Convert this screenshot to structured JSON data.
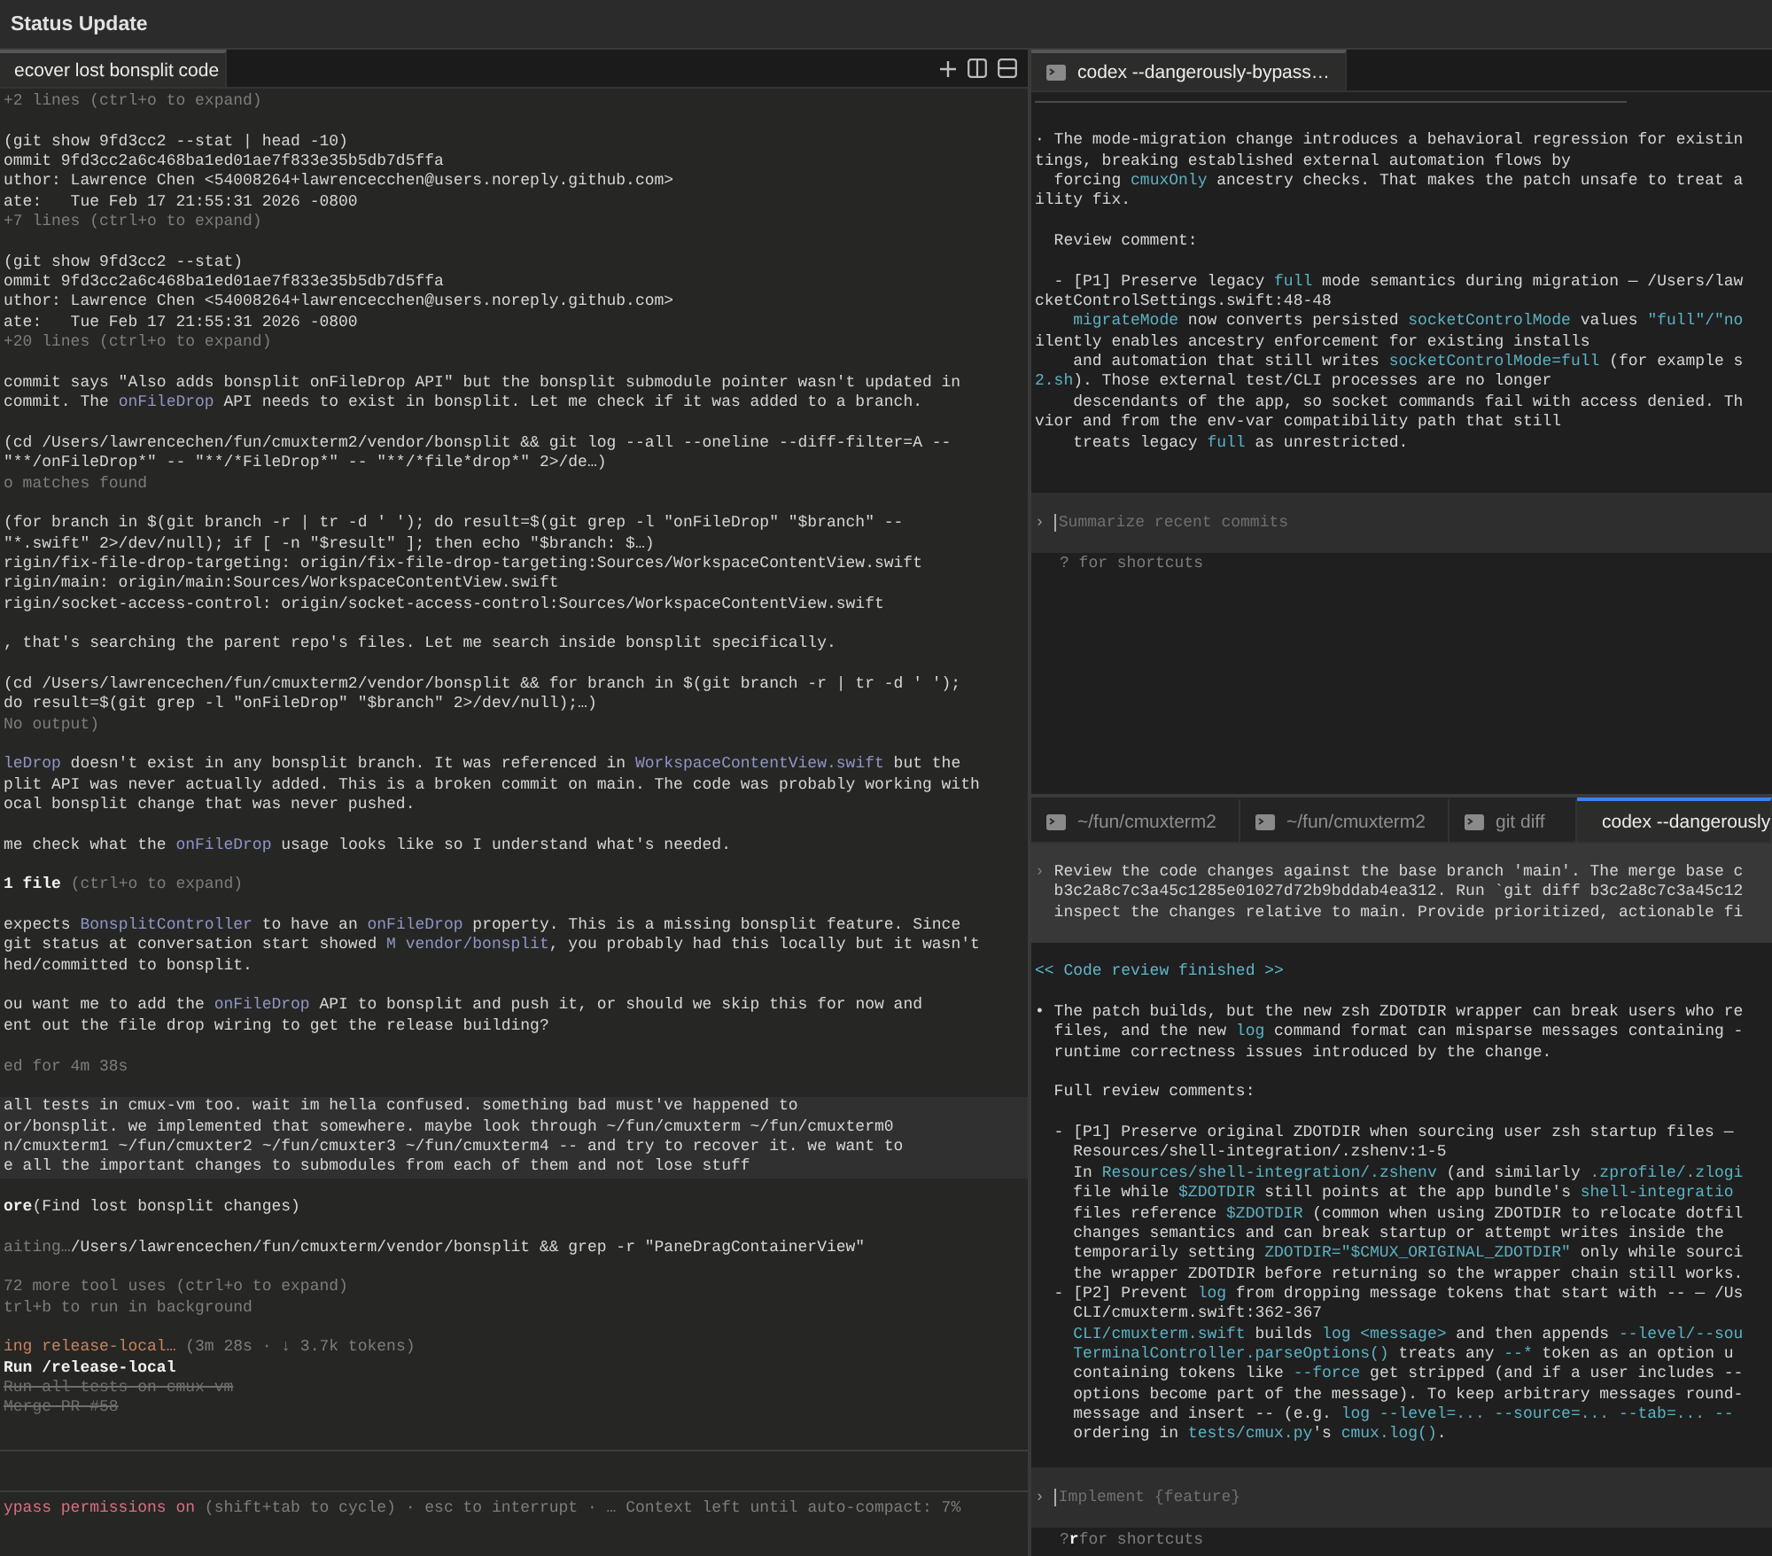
{
  "window": {
    "title": "Status Update"
  },
  "left_pane": {
    "tabs": [
      {
        "label": "ecover lost bonsplit code",
        "selected": true
      }
    ],
    "blocks": [
      {
        "kind": "output",
        "lines": [
          [
            {
              "text": "+2 lines (ctrl+o to expand)",
              "kind": "dim"
            }
          ]
        ]
      },
      {
        "kind": "output",
        "lines": [
          "(git show 9fd3cc2 --stat | head -10)",
          "ommit 9fd3cc2a6c468ba1ed01ae7f833e35b5db7d5ffa",
          "uthor: Lawrence Chen <54008264+lawrencecchen@users.noreply.github.com>",
          "ate:   Tue Feb 17 21:55:31 2026 -0800",
          [
            {
              "text": "+7 lines (ctrl+o to expand)",
              "kind": "dim"
            }
          ]
        ]
      },
      {
        "kind": "output",
        "lines": [
          "(git show 9fd3cc2 --stat)",
          "ommit 9fd3cc2a6c468ba1ed01ae7f833e35b5db7d5ffa",
          "uthor: Lawrence Chen <54008264+lawrencecchen@users.noreply.github.com>",
          "ate:   Tue Feb 17 21:55:31 2026 -0800",
          [
            {
              "text": "+20 lines (ctrl+o to expand)",
              "kind": "dim"
            }
          ]
        ]
      },
      {
        "kind": "output",
        "lines": [
          "commit says \"Also adds bonsplit onFileDrop API\" but the bonsplit submodule pointer wasn't updated in",
          [
            {
              "text": "commit. The ",
              "kind": "plain"
            },
            {
              "text": "onFileDrop",
              "kind": "accent"
            },
            {
              "text": " API needs to exist in bonsplit. Let me check if it was added to a branch.",
              "kind": "plain"
            }
          ]
        ]
      },
      {
        "kind": "output",
        "lines": [
          "(cd /Users/lawrencechen/fun/cmuxterm2/vendor/bonsplit && git log --all --oneline --diff-filter=A --",
          "\"**/onFileDrop*\" -- \"**/*FileDrop*\" -- \"**/*file*drop*\" 2>/de…)",
          [
            {
              "text": "o matches found",
              "kind": "dim"
            }
          ]
        ]
      },
      {
        "kind": "output",
        "lines": [
          "(for branch in $(git branch -r | tr -d ' '); do result=$(git grep -l \"onFileDrop\" \"$branch\" --",
          "\"*.swift\" 2>/dev/null); if [ -n \"$result\" ]; then echo \"$branch: $…)",
          "rigin/fix-file-drop-targeting: origin/fix-file-drop-targeting:Sources/WorkspaceContentView.swift",
          "rigin/main: origin/main:Sources/WorkspaceContentView.swift",
          "rigin/socket-access-control: origin/socket-access-control:Sources/WorkspaceContentView.swift"
        ]
      },
      {
        "kind": "output",
        "lines": [
          ", that's searching the parent repo's files. Let me search inside bonsplit specifically."
        ]
      },
      {
        "kind": "output",
        "lines": [
          "(cd /Users/lawrencechen/fun/cmuxterm2/vendor/bonsplit && for branch in $(git branch -r | tr -d ' ');",
          "do result=$(git grep -l \"onFileDrop\" \"$branch\" 2>/dev/null);…)",
          [
            {
              "text": "No output)",
              "kind": "dim"
            }
          ]
        ]
      },
      {
        "kind": "output",
        "lines": [
          [
            {
              "text": "leDrop",
              "kind": "accent"
            },
            {
              "text": " doesn't exist in any bonsplit branch. It was referenced in ",
              "kind": "plain"
            },
            {
              "text": "WorkspaceContentView.swift",
              "kind": "accent"
            },
            {
              "text": " but the",
              "kind": "plain"
            }
          ],
          "plit API was never actually added. This is a broken commit on main. The code was probably working with",
          "ocal bonsplit change that was never pushed."
        ]
      },
      {
        "kind": "output",
        "lines": [
          [
            {
              "text": "me check what the ",
              "kind": "plain"
            },
            {
              "text": "onFileDrop",
              "kind": "accent"
            },
            {
              "text": " usage looks like so I understand what's needed.",
              "kind": "plain"
            }
          ]
        ]
      },
      {
        "kind": "output",
        "lines": [
          [
            {
              "text": "1 file ",
              "kind": "bold"
            },
            {
              "text": "(ctrl+o to expand)",
              "kind": "dim"
            }
          ]
        ]
      },
      {
        "kind": "output",
        "lines": [
          [
            {
              "text": "expects ",
              "kind": "plain"
            },
            {
              "text": "BonsplitController",
              "kind": "accent"
            },
            {
              "text": " to have an ",
              "kind": "plain"
            },
            {
              "text": "onFileDrop",
              "kind": "accent"
            },
            {
              "text": " property. This is a missing bonsplit feature. Since",
              "kind": "plain"
            }
          ],
          [
            {
              "text": "git status at conversation start showed ",
              "kind": "plain"
            },
            {
              "text": "M vendor/bonsplit",
              "kind": "accent"
            },
            {
              "text": ", you probably had this locally but it wasn't",
              "kind": "plain"
            }
          ],
          "hed/committed to bonsplit."
        ]
      },
      {
        "kind": "output",
        "lines": [
          [
            {
              "text": "ou want me to add the ",
              "kind": "plain"
            },
            {
              "text": "onFileDrop",
              "kind": "accent"
            },
            {
              "text": " API to bonsplit and push it, or should we skip this for now and",
              "kind": "plain"
            }
          ],
          "ent out the file drop wiring to get the release building?"
        ]
      },
      {
        "kind": "output",
        "lines": [
          [
            {
              "text": "ed for 4m 38s",
              "kind": "dim"
            }
          ]
        ]
      },
      {
        "kind": "user",
        "lines": [
          "all tests in cmux-vm too. wait im hella confused. something bad must've happened to",
          "or/bonsplit. we implemented that somewhere. maybe look through ~/fun/cmuxterm ~/fun/cmuxterm0",
          "n/cmuxterm1 ~/fun/cmuxter2 ~/fun/cmuxter3 ~/fun/cmuxterm4 -- and try to recover it. we want to",
          "e all the important changes to submodules from each of them and not lose stuff"
        ]
      },
      {
        "kind": "output",
        "lines": [
          [
            {
              "text": "ore",
              "kind": "bold"
            },
            {
              "text": "(Find lost bonsplit changes)",
              "kind": "plain"
            }
          ]
        ]
      },
      {
        "kind": "output",
        "lines": [
          [
            {
              "text": "aiting…",
              "kind": "dim"
            },
            {
              "text": "/Users/lawrencechen/fun/cmuxterm/vendor/bonsplit && grep -r \"PaneDragContainerView\"",
              "kind": "plain"
            }
          ]
        ]
      },
      {
        "kind": "output",
        "lines": [
          [
            {
              "text": "72 more tool uses (ctrl+o to expand)",
              "kind": "dim"
            }
          ],
          [
            {
              "text": "trl+b to run in background",
              "kind": "dim"
            }
          ]
        ]
      },
      {
        "kind": "output",
        "lines": [
          [
            {
              "text": "ing release-local…",
              "kind": "orange"
            },
            {
              "text": " (3m 28s · ↓ 3.7k tokens)",
              "kind": "dim"
            }
          ],
          [
            {
              "text": "Run /release-local",
              "kind": "bold"
            }
          ],
          [
            {
              "text": "Run all tests on cmux-vm",
              "kind": "strike"
            }
          ],
          [
            {
              "text": "Merge PR #58",
              "kind": "strike"
            }
          ]
        ]
      }
    ],
    "status_line": [
      {
        "text": "ypass permissions on",
        "kind": "red"
      },
      {
        "text": " (shift+tab to cycle) · esc to interrupt · … Context left until auto-compact: 7%",
        "kind": "dim"
      }
    ]
  },
  "right_top_pane": {
    "tabs": [
      {
        "label": "codex --dangerously-bypass…",
        "selected": true
      }
    ],
    "blocks": [
      {
        "kind": "output",
        "lines": [
          "· The mode-migration change introduces a behavioral regression for existin",
          "tings, breaking established external automation flows by",
          [
            {
              "text": "  forcing ",
              "kind": "plain"
            },
            {
              "text": "cmuxOnly",
              "kind": "teal"
            },
            {
              "text": " ancestry checks. That makes the patch unsafe to treat a",
              "kind": "plain"
            }
          ],
          "ility fix."
        ]
      },
      {
        "kind": "output",
        "lines": [
          "  Review comment:"
        ]
      },
      {
        "kind": "output",
        "lines": [
          [
            {
              "text": "  - [P1] Preserve legacy ",
              "kind": "plain"
            },
            {
              "text": "full",
              "kind": "teal"
            },
            {
              "text": " mode semantics during migration — /Users/law",
              "kind": "plain"
            }
          ],
          "cketControlSettings.swift:48-48",
          [
            {
              "text": "    migrateMode",
              "kind": "teal"
            },
            {
              "text": " now converts persisted ",
              "kind": "plain"
            },
            {
              "text": "socketControlMode",
              "kind": "teal"
            },
            {
              "text": " values ",
              "kind": "plain"
            },
            {
              "text": "\"full\"/\"no",
              "kind": "teal"
            }
          ],
          "ilently enables ancestry enforcement for existing installs",
          [
            {
              "text": "    and automation that still writes ",
              "kind": "plain"
            },
            {
              "text": "socketControlMode=full",
              "kind": "teal"
            },
            {
              "text": " (for example s",
              "kind": "plain"
            }
          ],
          [
            {
              "text": "2.sh",
              "kind": "teal"
            },
            {
              "text": "). Those external test/CLI processes are no longer",
              "kind": "plain"
            }
          ],
          "    descendants of the app, so socket commands fail with access denied. Th",
          "vior and from the env-var compatibility path that still",
          [
            {
              "text": "    treats legacy ",
              "kind": "plain"
            },
            {
              "text": "full",
              "kind": "teal"
            },
            {
              "text": " as unrestricted.",
              "kind": "plain"
            }
          ]
        ]
      }
    ],
    "input": {
      "prompt": "›",
      "placeholder": "Summarize recent commits"
    },
    "hint": [
      {
        "text": "? for shortcuts",
        "kind": "dim"
      }
    ]
  },
  "right_bottom_pane": {
    "tabs": [
      {
        "label": "~/fun/cmuxterm2",
        "selected": false
      },
      {
        "label": "~/fun/cmuxterm2",
        "selected": false
      },
      {
        "label": "git diff",
        "selected": false
      },
      {
        "label": "codex --dangerously",
        "selected": true
      }
    ],
    "blocks": [
      {
        "kind": "user",
        "lines": [
          [
            {
              "text": "› ",
              "kind": "dim"
            },
            {
              "text": "Review the code changes against the base branch 'main'. The merge base c",
              "kind": "plain"
            }
          ],
          "  b3c2a8c7c3a45c1285e01027d72b9bddab4ea312. Run `git diff b3c2a8c7c3a45c12",
          "  inspect the changes relative to main. Provide prioritized, actionable fi"
        ]
      },
      {
        "kind": "output",
        "lines": [
          [
            {
              "text": "<< Code review finished >>",
              "kind": "cyan"
            }
          ]
        ]
      },
      {
        "kind": "output",
        "lines": [
          "• The patch builds, but the new zsh ZDOTDIR wrapper can break users who re",
          [
            {
              "text": "  files, and the new ",
              "kind": "plain"
            },
            {
              "text": "log",
              "kind": "teal"
            },
            {
              "text": " command format can misparse messages containing -",
              "kind": "plain"
            }
          ],
          "  runtime correctness issues introduced by the change."
        ]
      },
      {
        "kind": "output",
        "lines": [
          "  Full review comments:"
        ]
      },
      {
        "kind": "output",
        "lines": [
          "  - [P1] Preserve original ZDOTDIR when sourcing user zsh startup files —",
          "    Resources/shell-integration/.zshenv:1-5",
          [
            {
              "text": "    In ",
              "kind": "plain"
            },
            {
              "text": "Resources/shell-integration/.zshenv",
              "kind": "teal"
            },
            {
              "text": " (and similarly ",
              "kind": "plain"
            },
            {
              "text": ".zprofile/.zlogi",
              "kind": "teal"
            }
          ],
          [
            {
              "text": "    file while ",
              "kind": "plain"
            },
            {
              "text": "$ZDOTDIR",
              "kind": "teal"
            },
            {
              "text": " still points at the app bundle's ",
              "kind": "plain"
            },
            {
              "text": "shell-integratio",
              "kind": "teal"
            }
          ],
          [
            {
              "text": "    files reference ",
              "kind": "plain"
            },
            {
              "text": "$ZDOTDIR",
              "kind": "teal"
            },
            {
              "text": " (common when using ZDOTDIR to relocate dotfil",
              "kind": "plain"
            }
          ],
          "    changes semantics and can break startup or attempt writes inside the",
          [
            {
              "text": "    temporarily setting ",
              "kind": "plain"
            },
            {
              "text": "ZDOTDIR=\"$CMUX_ORIGINAL_ZDOTDIR\"",
              "kind": "teal"
            },
            {
              "text": " only while sourci",
              "kind": "plain"
            }
          ],
          "    the wrapper ZDOTDIR before returning so the wrapper chain still works.",
          [
            {
              "text": "  - [P2] Prevent ",
              "kind": "plain"
            },
            {
              "text": "log",
              "kind": "teal"
            },
            {
              "text": " from dropping message tokens that start with -- — /Us",
              "kind": "plain"
            }
          ],
          "    CLI/cmuxterm.swift:362-367",
          [
            {
              "text": "    CLI/cmuxterm.swift",
              "kind": "teal"
            },
            {
              "text": " builds ",
              "kind": "plain"
            },
            {
              "text": "log <message>",
              "kind": "teal"
            },
            {
              "text": " and then appends ",
              "kind": "plain"
            },
            {
              "text": "--level/--sou",
              "kind": "teal"
            }
          ],
          [
            {
              "text": "    TerminalController.parseOptions()",
              "kind": "teal"
            },
            {
              "text": " treats any ",
              "kind": "plain"
            },
            {
              "text": "--*",
              "kind": "teal"
            },
            {
              "text": " token as an option u",
              "kind": "plain"
            }
          ],
          [
            {
              "text": "    containing tokens like ",
              "kind": "plain"
            },
            {
              "text": "--force",
              "kind": "teal"
            },
            {
              "text": " get stripped (and if a user includes --",
              "kind": "plain"
            }
          ],
          "    options become part of the message). To keep arbitrary messages round-",
          [
            {
              "text": "    message and insert -- (e.g. ",
              "kind": "plain"
            },
            {
              "text": "log --level=... --source=... --tab=... --",
              "kind": "teal"
            }
          ],
          [
            {
              "text": "    ordering in ",
              "kind": "plain"
            },
            {
              "text": "tests/cmux.py",
              "kind": "teal"
            },
            {
              "text": "'s ",
              "kind": "plain"
            },
            {
              "text": "cmux.log()",
              "kind": "teal"
            },
            {
              "text": ".",
              "kind": "plain"
            }
          ]
        ]
      }
    ],
    "input": {
      "prompt": "›",
      "placeholder": "Implement {feature}"
    },
    "hint": [
      {
        "text": "?",
        "kind": "dim"
      },
      {
        "text": "r",
        "kind": "bold"
      },
      {
        "text": "for shortcuts",
        "kind": "dim"
      }
    ]
  }
}
